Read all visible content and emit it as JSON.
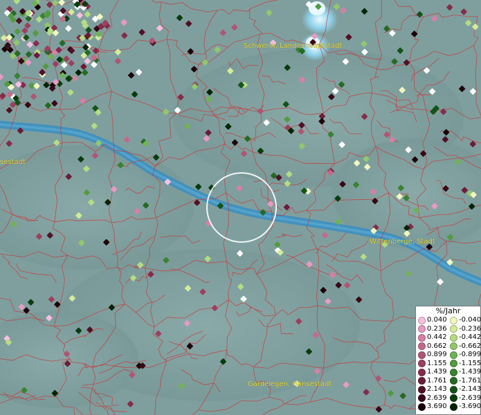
{
  "map": {
    "place_labels": [
      {
        "id": "schwerin",
        "text": "Schwerin, Landeshauptstadt"
      },
      {
        "id": "hansestadt-west",
        "text": "sestadt"
      },
      {
        "id": "wittenberge",
        "text": "Wittenberge, Stadt"
      },
      {
        "id": "gardelegen",
        "text": "Gardelegen, Hansestadt"
      }
    ],
    "colors": {
      "background": "#7f9f9f",
      "river": "#3d8fbf",
      "lake": "#c9ecf5",
      "boundaries": "#c73a3a",
      "label_text": "#e3dc36",
      "selection_circle": "#ffffff"
    }
  },
  "legend": {
    "title": "%/Jahr",
    "positive": [
      {
        "label": "0.040",
        "color": "#f7bfe0"
      },
      {
        "label": "0.236",
        "color": "#e79ac4"
      },
      {
        "label": "0.442",
        "color": "#d680a6"
      },
      {
        "label": "0.662",
        "color": "#c46a8a"
      },
      {
        "label": "0.899",
        "color": "#b05573"
      },
      {
        "label": "1.155",
        "color": "#9c405f"
      },
      {
        "label": "1.439",
        "color": "#852c4a"
      },
      {
        "label": "1.761",
        "color": "#6c1c36"
      },
      {
        "label": "2.143",
        "color": "#521024"
      },
      {
        "label": "2.639",
        "color": "#370716"
      },
      {
        "label": "3.690",
        "color": "#1c0008"
      }
    ],
    "negative": [
      {
        "label": "-0.040",
        "color": "#f2f7c0"
      },
      {
        "label": "-0.236",
        "color": "#d4ec9a"
      },
      {
        "label": "-0.442",
        "color": "#b4dc82"
      },
      {
        "label": "-0.662",
        "color": "#92c86c"
      },
      {
        "label": "-0.899",
        "color": "#71b256"
      },
      {
        "label": "-1.155",
        "color": "#549a42"
      },
      {
        "label": "-1.439",
        "color": "#3b8232"
      },
      {
        "label": "-1.761",
        "color": "#266a24"
      },
      {
        "label": "-2.143",
        "color": "#145318"
      },
      {
        "label": "-2.639",
        "color": "#083c0e"
      },
      {
        "label": "-3.690",
        "color": "#022405"
      }
    ]
  }
}
